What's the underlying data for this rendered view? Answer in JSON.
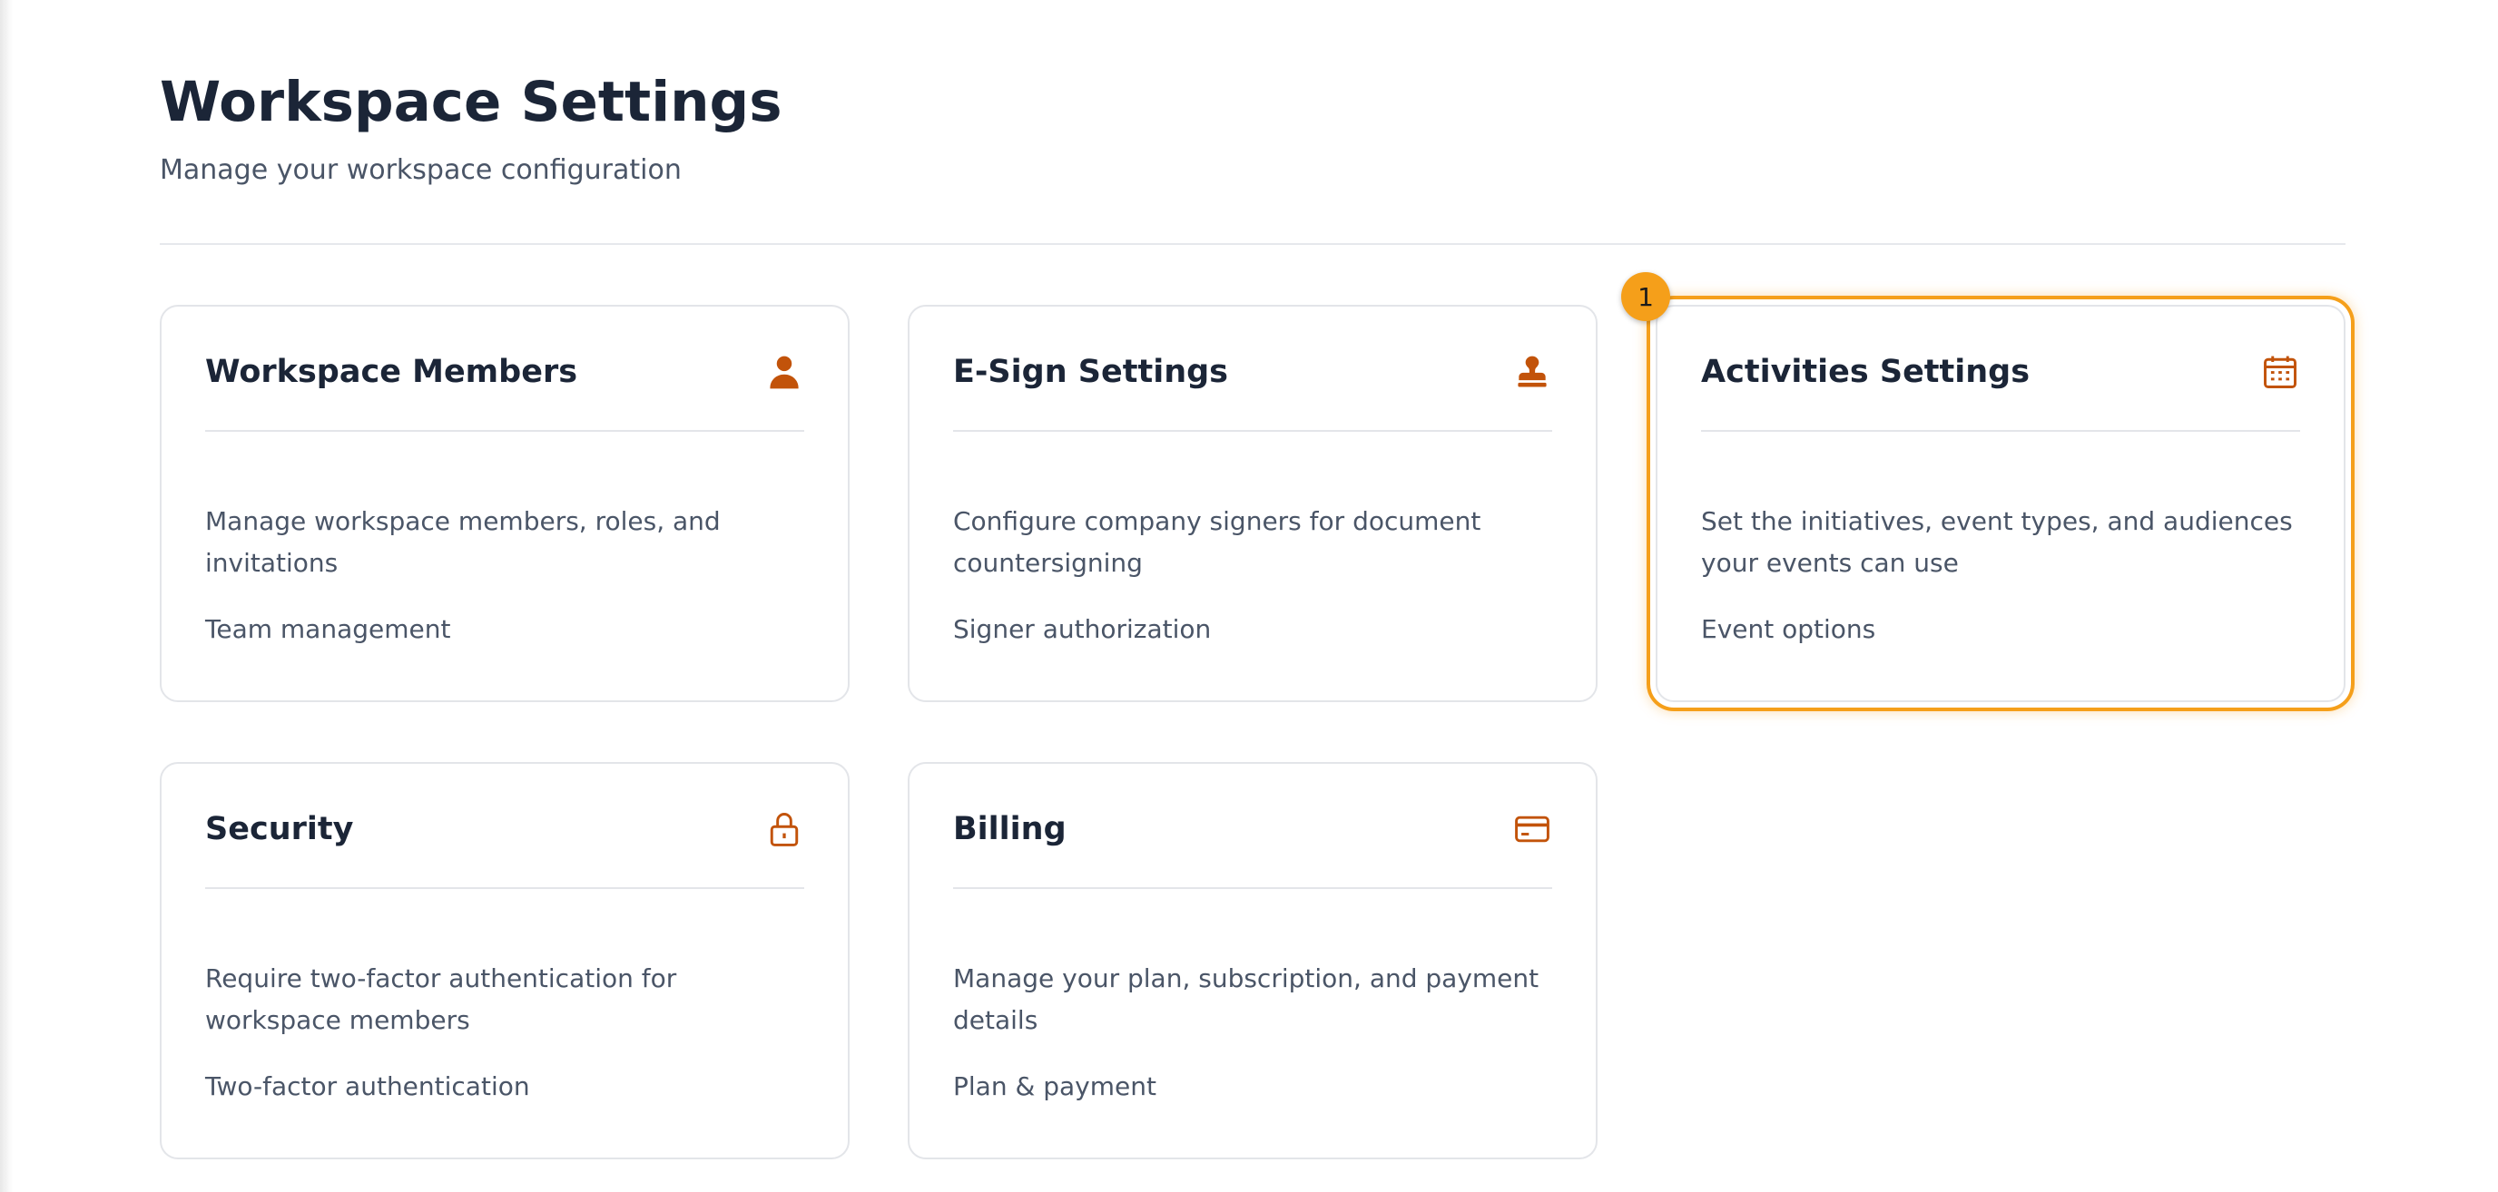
{
  "page": {
    "title": "Workspace Settings",
    "subtitle": "Manage your workspace configuration"
  },
  "cards": [
    {
      "title": "Workspace Members",
      "icon": "person-icon",
      "description": "Manage workspace members, roles, and invitations",
      "meta": "Team management"
    },
    {
      "title": "E-Sign Settings",
      "icon": "stamp-icon",
      "description": "Configure company signers for document countersigning",
      "meta": "Signer authorization"
    },
    {
      "title": "Activities Settings",
      "icon": "calendar-icon",
      "description": "Set the initiatives, event types, and audiences your events can use",
      "meta": "Event options"
    },
    {
      "title": "Security",
      "icon": "lock-icon",
      "description": "Require two-factor authentication for workspace members",
      "meta": "Two-factor authentication"
    },
    {
      "title": "Billing",
      "icon": "credit-card-icon",
      "description": "Manage your plan, subscription, and payment details",
      "meta": "Plan & payment"
    }
  ],
  "highlight": {
    "badge_label": "1"
  },
  "colors": {
    "accent": "#c2530a",
    "highlight": "#f59f1a",
    "title": "#1b2537",
    "text": "#4a5567",
    "border": "#e3e5e9"
  }
}
